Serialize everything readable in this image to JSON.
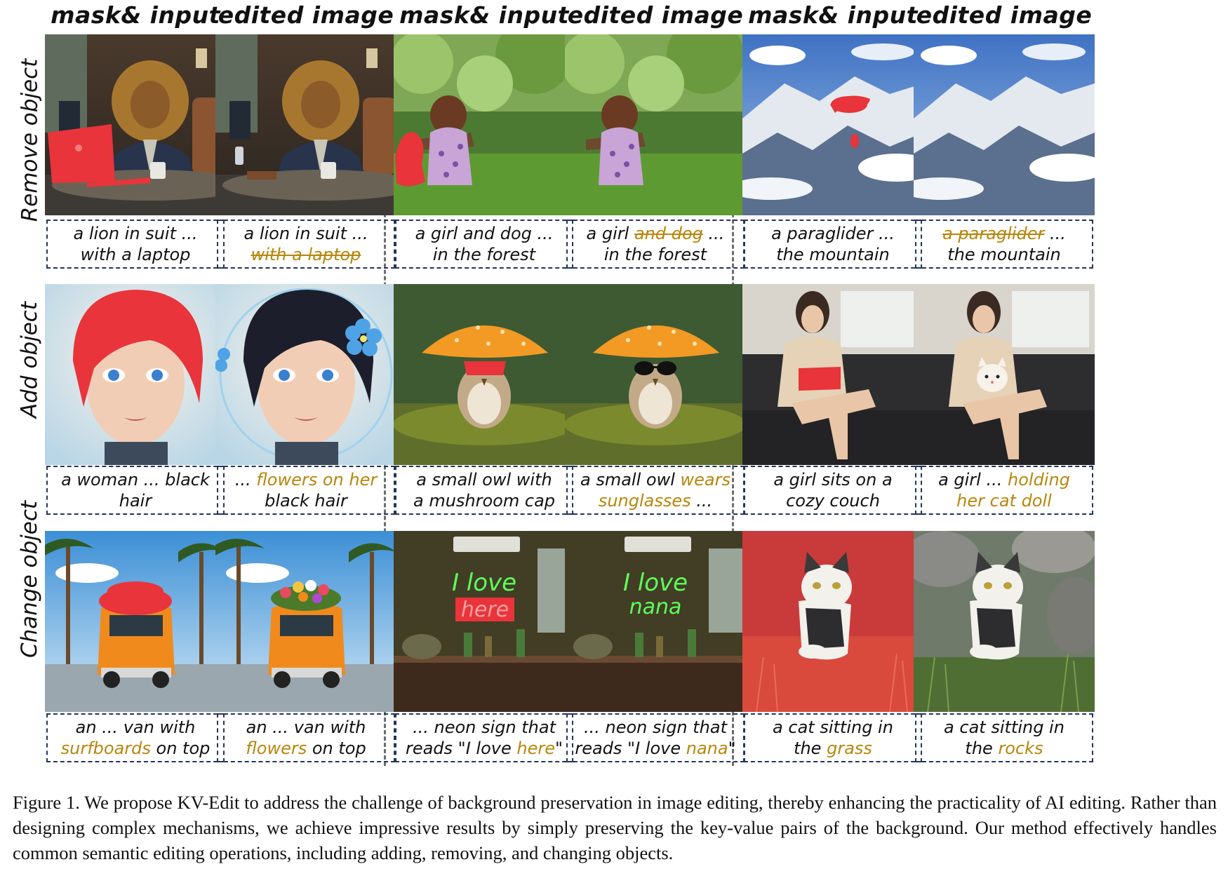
{
  "column_headers": [
    "mask& input",
    "edited image",
    "mask& input",
    "edited image",
    "mask& input",
    "edited image"
  ],
  "row_labels": [
    "Remove object",
    "Add object",
    "Change object"
  ],
  "captions": {
    "r0c0": {
      "l1": "a lion in suit ...",
      "l2": "with a laptop"
    },
    "r0c1": {
      "l1": "a lion in suit ...",
      "l2_strike": "with a laptop"
    },
    "r0c2": {
      "l1": "a girl and dog ...",
      "l2": "in the forest"
    },
    "r0c3": {
      "l1a": "a girl",
      "l1_strike": "and dog",
      "l1b": "...",
      "l2": "in the forest"
    },
    "r0c4": {
      "l1": "a paraglider ...",
      "l2": "the mountain"
    },
    "r0c5": {
      "l1_strike": "a paraglider",
      "l1b": "...",
      "l2": "the mountain"
    },
    "r1c0": {
      "l1": "a woman ... black",
      "l2": "hair"
    },
    "r1c1": {
      "l1a": "...",
      "l1_hl": "flowers on her",
      "l2": "black hair"
    },
    "r1c2": {
      "l1": "a small owl with",
      "l2": "a mushroom cap"
    },
    "r1c3": {
      "l1a": "a small owl",
      "l1_hl": "wears",
      "l2_hl": "sunglasses",
      "l2b": "..."
    },
    "r1c4": {
      "l1": "a girl sits on a",
      "l2": "cozy couch"
    },
    "r1c5": {
      "l1a": "a girl ...",
      "l1_hl": "holding",
      "l2_hl": "her cat doll"
    },
    "r2c0": {
      "l1": "an ... van with",
      "l2_hl": "surfboards",
      "l2b": "on top"
    },
    "r2c1": {
      "l1": "an ... van with",
      "l2_hl": "flowers",
      "l2b": "on top"
    },
    "r2c2": {
      "l1": "... neon sign that",
      "l2a": "reads \"I love",
      "l2_hl": "here",
      "l2b": "\""
    },
    "r2c3": {
      "l1": "... neon sign that",
      "l2a": "reads \"I love",
      "l2_hl": "nana",
      "l2b": "\""
    },
    "r2c4": {
      "l1": "a cat sitting in",
      "l2a": "the",
      "l2_hl": "grass"
    },
    "r2c5": {
      "l1": "a cat sitting in",
      "l2a": "the",
      "l2_hl": "rocks"
    }
  },
  "image_text": {
    "neon_line1": "I love",
    "neon_here": "here",
    "neon_nana": "nana"
  },
  "figure_caption": "Figure 1. We propose KV-Edit to address the challenge of background preservation in image editing, thereby enhancing the practicality of AI editing. Rather than designing complex mechanisms, we achieve impressive results by simply preserving the key-value pairs of the background. Our method effectively handles common semantic editing operations, including adding, removing, and changing objects.",
  "colors": {
    "highlight": "#b8860b",
    "mask": "#e8343a",
    "caption_border": "#23345c"
  }
}
